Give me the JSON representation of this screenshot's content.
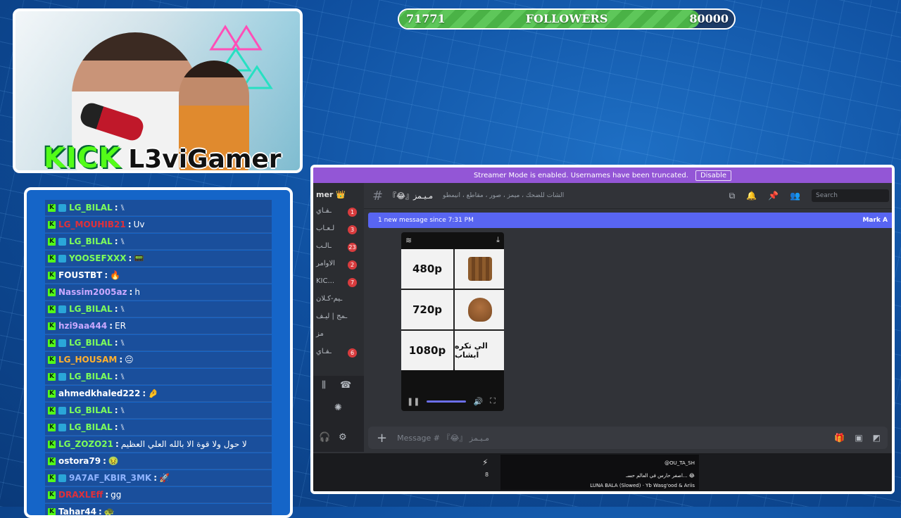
{
  "followers": {
    "current": "71771",
    "label": "FOLLOWERS",
    "goal": "80000",
    "progress": 0.897
  },
  "brand": {
    "platform": "KICK",
    "streamer": "L3viGamer"
  },
  "chat": [
    {
      "user": "LG_BILAL",
      "color": "#7dff5a",
      "badge": true,
      "text": "⑊"
    },
    {
      "user": "LG_MOUHIB21",
      "color": "#e0303a",
      "badge": false,
      "text": "Uv"
    },
    {
      "user": "LG_BILAL",
      "color": "#7dff5a",
      "badge": true,
      "text": "⑊"
    },
    {
      "user": "YOOSEFXXX",
      "color": "#7dff5a",
      "badge": true,
      "text": "📟"
    },
    {
      "user": "FOUSTBT",
      "color": "#ffffff",
      "badge": false,
      "text": "🔥"
    },
    {
      "user": "Nassim2005az",
      "color": "#c9a8ff",
      "badge": false,
      "text": "h"
    },
    {
      "user": "LG_BILAL",
      "color": "#7dff5a",
      "badge": true,
      "text": "⑊"
    },
    {
      "user": "hzi9aa444",
      "color": "#c9a8ff",
      "badge": false,
      "text": "ER"
    },
    {
      "user": "LG_BILAL",
      "color": "#7dff5a",
      "badge": true,
      "text": "⑊"
    },
    {
      "user": "LG_HOUSAM",
      "color": "#ffb02e",
      "badge": false,
      "text": "😐"
    },
    {
      "user": "LG_BILAL",
      "color": "#7dff5a",
      "badge": true,
      "text": "⑊"
    },
    {
      "user": "ahmedkhaled222",
      "color": "#ffffff",
      "badge": false,
      "text": "🤌"
    },
    {
      "user": "LG_BILAL",
      "color": "#7dff5a",
      "badge": true,
      "text": "⑊"
    },
    {
      "user": "LG_BILAL",
      "color": "#7dff5a",
      "badge": true,
      "text": "⑊"
    },
    {
      "user": "LG_ZOZO21",
      "color": "#7dff5a",
      "badge": false,
      "text": "لا حول ولا قوة الا بالله العلي العظيم"
    },
    {
      "user": "ostora79",
      "color": "#ffffff",
      "badge": false,
      "text": "🤢"
    },
    {
      "user": "9A7AF_KBIR_3MK",
      "color": "#8fb3ff",
      "badge": true,
      "text": "🚀"
    },
    {
      "user": "DRAXLEff",
      "color": "#e0303a",
      "badge": false,
      "text": "gg"
    },
    {
      "user": "Tahar44",
      "color": "#ffffff",
      "badge": false,
      "text": "🐢"
    }
  ],
  "discord": {
    "streamer_mode": "Streamer Mode is enabled. Usernames have been truncated.",
    "disable": "Disable",
    "server": "mer 👑",
    "channels": [
      {
        "name": "ـفـاي",
        "badge": "1"
      },
      {
        "name": "لـعـاب",
        "badge": "3"
      },
      {
        "name": "ـالـب",
        "badge": "23"
      },
      {
        "name": "الاوامر",
        "badge": "2"
      },
      {
        "name": "KIC...",
        "badge": "7"
      },
      {
        "name": "ـيم-كـلان",
        "badge": ""
      },
      {
        "name": "ـمج | ليـف",
        "badge": ""
      },
      {
        "name": "مز",
        "badge": ""
      },
      {
        "name": "ـفـاي",
        "badge": "6"
      }
    ],
    "channel": "『😂』مـيـمز",
    "topic": "الشات للضحك ، ميمز ، صور ، مقاطع ، انيمطو",
    "search": "Search",
    "new_message": "1 new message since 7:31 PM",
    "mark": "Mark A",
    "video": {
      "r1": "480p",
      "r2": "720p",
      "r3": "1080p",
      "arabic": "الي تكره ابشاب"
    },
    "composer": "Message # 『😂』 مـيـمز",
    "clip": {
      "handle": "@OU_TA_SH",
      "line2": "اصغر حارس في العالم حسـ... 😂",
      "song": "LUNA BALA (Slowed) · Yb Wasg'ood & Ariis"
    },
    "strip_count": "8"
  }
}
